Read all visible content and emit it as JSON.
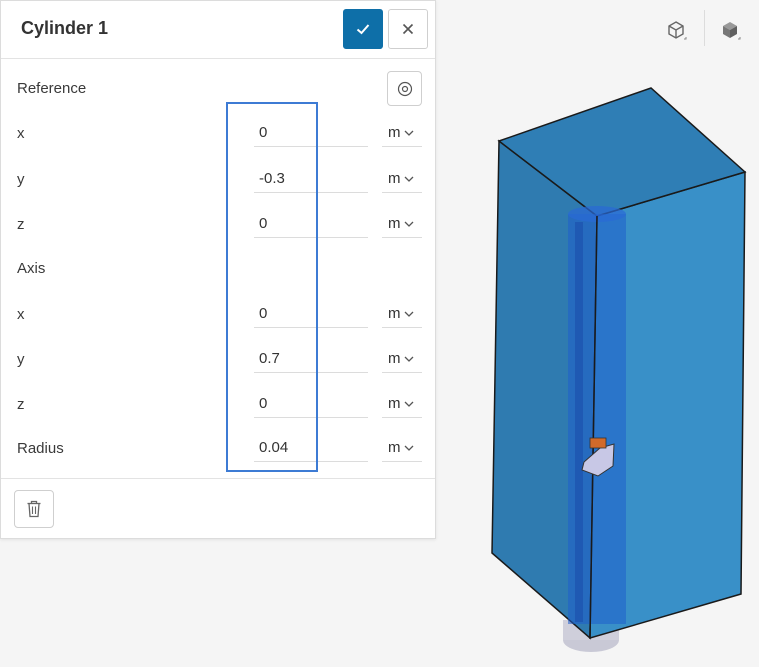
{
  "panel": {
    "title": "Cylinder 1",
    "confirm_icon": "check-icon",
    "close_icon": "close-icon",
    "reference": {
      "label": "Reference",
      "x_label": "x",
      "x_value": "0",
      "x_unit": "m",
      "y_label": "y",
      "y_value": "-0.3",
      "y_unit": "m",
      "z_label": "z",
      "z_value": "0",
      "z_unit": "m"
    },
    "axis": {
      "label": "Axis",
      "x_label": "x",
      "x_value": "0",
      "x_unit": "m",
      "y_label": "y",
      "y_value": "0.7",
      "y_unit": "m",
      "z_label": "z",
      "z_value": "0",
      "z_unit": "m"
    },
    "radius": {
      "label": "Radius",
      "value": "0.04",
      "unit": "m"
    },
    "delete_icon": "trash-icon",
    "target_icon": "target-icon"
  },
  "viewer": {
    "view_buttons": [
      "wireframe-cube-icon",
      "solid-cube-icon"
    ],
    "colors": {
      "box_front": "#2f7bb0",
      "box_side": "#3990c8",
      "box_top": "#2f7eb5",
      "cylinder": "#1f5fcc",
      "accent": "#0e6fa8",
      "highlight": "#3d7bd4"
    }
  }
}
